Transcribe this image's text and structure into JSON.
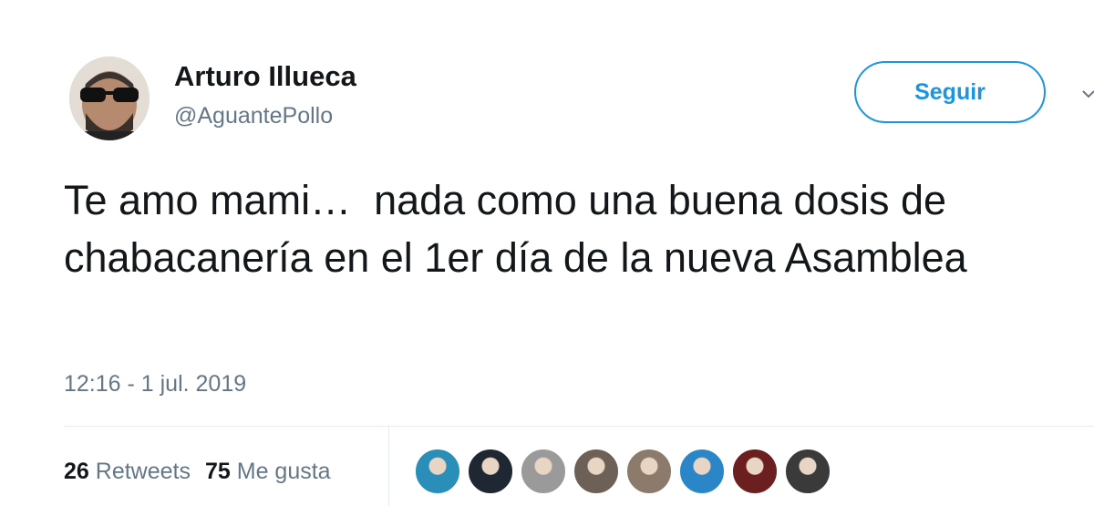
{
  "author": {
    "display_name": "Arturo Illueca",
    "handle": "@AguantePollo"
  },
  "follow_button": {
    "label": "Seguir",
    "color": "#1b95e0"
  },
  "tweet": {
    "text": "Te amo mami…  nada como una buena dosis de chabacanería en el 1er día de la nueva Asamblea",
    "timestamp": "12:16 - 1 jul. 2019"
  },
  "stats": {
    "retweets_count": "26",
    "retweets_label": "Retweets",
    "likes_count": "75",
    "likes_label": "Me gusta"
  },
  "likers": [
    {
      "name": "liker-avatar-1",
      "color": "#2a8fb8"
    },
    {
      "name": "liker-avatar-2",
      "color": "#1f2733"
    },
    {
      "name": "liker-avatar-3",
      "color": "#9a9a9a"
    },
    {
      "name": "liker-avatar-4",
      "color": "#6d6157"
    },
    {
      "name": "liker-avatar-5",
      "color": "#8c7a6b"
    },
    {
      "name": "liker-avatar-6",
      "color": "#2b86c8"
    },
    {
      "name": "liker-avatar-7",
      "color": "#6b1f1f"
    },
    {
      "name": "liker-avatar-8",
      "color": "#3a3a3a"
    }
  ]
}
